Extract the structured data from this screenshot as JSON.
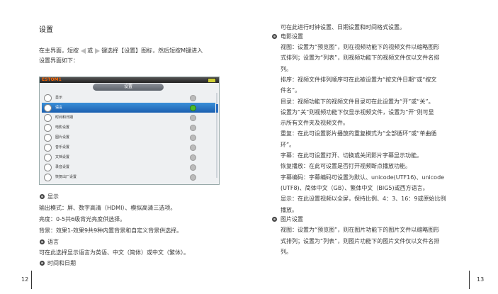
{
  "left": {
    "title": "设置",
    "intro_p1": "在主界面，短按",
    "intro_p2": "或",
    "intro_p3": "键选择【设置】图标，然后短按M键进入",
    "intro_line2": "设置界面如下：",
    "screenshot": {
      "logo": "ESTOM1",
      "tab": "设置",
      "items": [
        "显示",
        "语言",
        "时间和日期",
        "电影设置",
        "图片设置",
        "音乐设置",
        "文档设置",
        "录音设置",
        "恢复出厂设置"
      ],
      "selected_index": 1
    },
    "display_heading": "显示",
    "display_lines": [
      "输出模式：屏、数字高清（HDMI）、模拟高清三选项。",
      "亮度：0-5共6级背光亮度供选择。",
      "背景：效果1-效果9共9种内置背景和自定义背景供选择。"
    ],
    "language_heading": "语言",
    "language_lines": [
      "可在此选择显示语言为英语、中文（简体）或中文（繁体）。"
    ],
    "datetime_heading": "时间和日期",
    "page_number": "12"
  },
  "right": {
    "intro_line": "可在此进行时钟设置、日期设置和时间格式设置。",
    "movie_heading": "电影设置",
    "movie_lines": [
      "视图：设置为“预览图”，则在视频功能下的视频文件以缩略图形",
      "式排列；设置为“列表”，则视频功能下的视频文件仅以文件名排",
      "列。",
      "排序：视频文件排列顺序可在此被设置为“按文件日期”或“按文",
      "件名”。",
      "目录：视频功能下的视频文件目录可在此设置为“开”或“关”。",
      "设置为“关”则视频功能下仅显示视频文件，设置为“开”则可显",
      "示所有文件夹及视频文件。",
      "重复：在此可设置影片播放的重复模式为“全部循环”或“单曲循",
      "环”。",
      "字幕：在此可设置打开、切换或关闭影片字幕显示功能。",
      "恢复播放：在此可设置是否打开视频断点播放功能。",
      "字幕编码：字幕编码可设置为默认、unicode(UTF16)、unicode",
      "(UTF8)、简体中文（GB）、繁体中文（BIG5)或西方语言。",
      "显示：在此设置视频以全屏，保持比例、4：3、16：9或原始比例",
      "播放。"
    ],
    "picture_heading": "图片设置",
    "picture_lines": [
      "视图：设置为“预览图”，则在图片功能下的图片文件以缩略图形",
      "式排列；设置为“列表”，则图片功能下的图片文件仅以文件名排",
      "列。"
    ],
    "page_number": "13"
  }
}
